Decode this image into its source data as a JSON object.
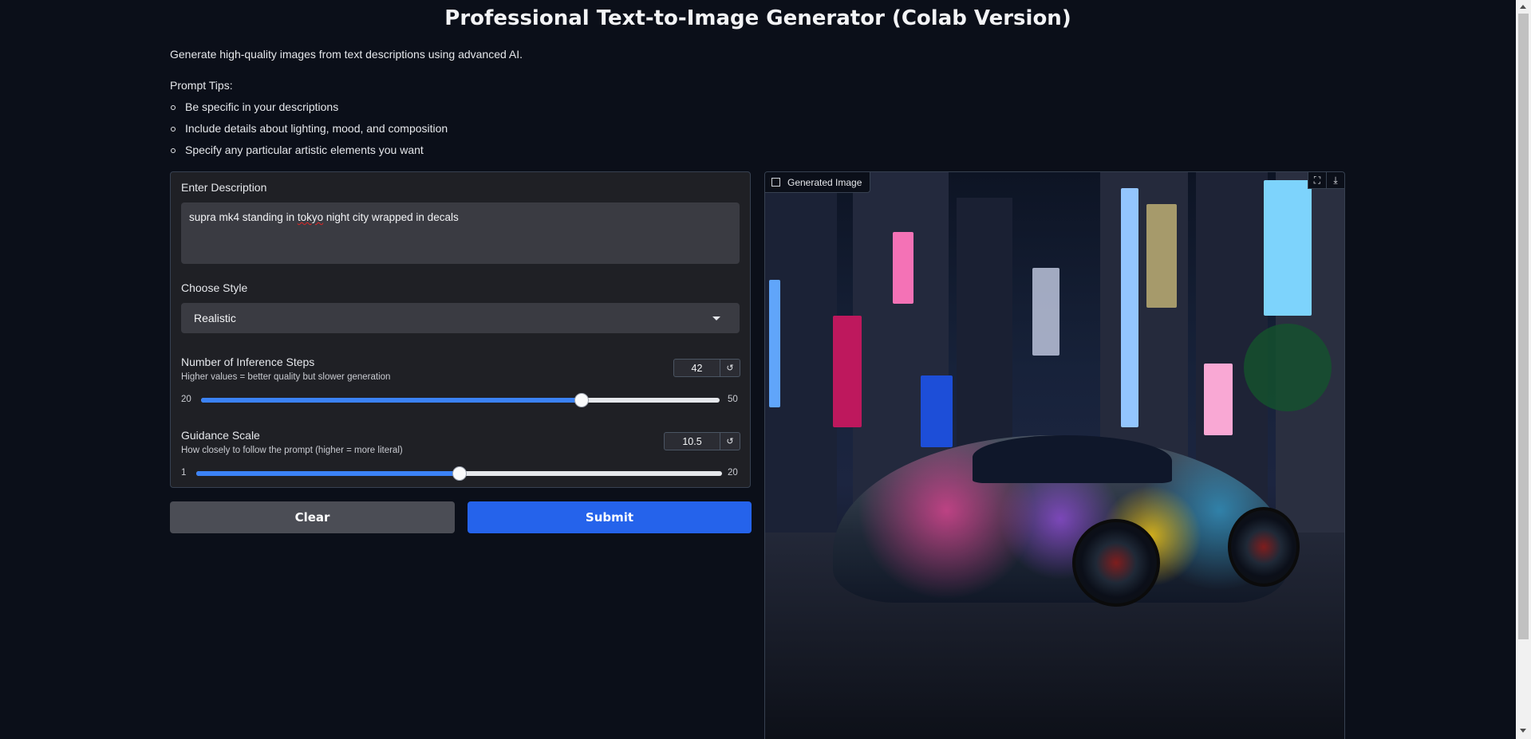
{
  "title": "Professional Text-to-Image Generator (Colab Version)",
  "intro": "Generate high-quality images from text descriptions using advanced AI.",
  "tips": {
    "heading": "Prompt Tips:",
    "items": [
      "Be specific in your descriptions",
      "Include details about lighting, mood, and composition",
      "Specify any particular artistic elements you want"
    ]
  },
  "description": {
    "label": "Enter Description",
    "value_before": "supra mk4  standing  in ",
    "value_typo": "tokyo",
    "value_after": " night city wrapped in decals"
  },
  "style": {
    "label": "Choose Style",
    "selected": "Realistic"
  },
  "steps": {
    "label": "Number of Inference Steps",
    "info": "Higher values = better quality but slower generation",
    "value": "42",
    "min": "20",
    "max": "50",
    "fraction": 0.7333
  },
  "guidance": {
    "label": "Guidance Scale",
    "info": "How closely to follow the prompt (higher = more literal)",
    "value": "10.5",
    "min": "1",
    "max": "20",
    "fraction": 0.5
  },
  "buttons": {
    "clear": "Clear",
    "submit": "Submit"
  },
  "output": {
    "label": "Generated Image",
    "tools": [
      "fullscreen-icon",
      "download-icon"
    ]
  },
  "colors": {
    "accent": "#2563eb",
    "background": "#0b0f19",
    "panel": "#1f2025"
  }
}
